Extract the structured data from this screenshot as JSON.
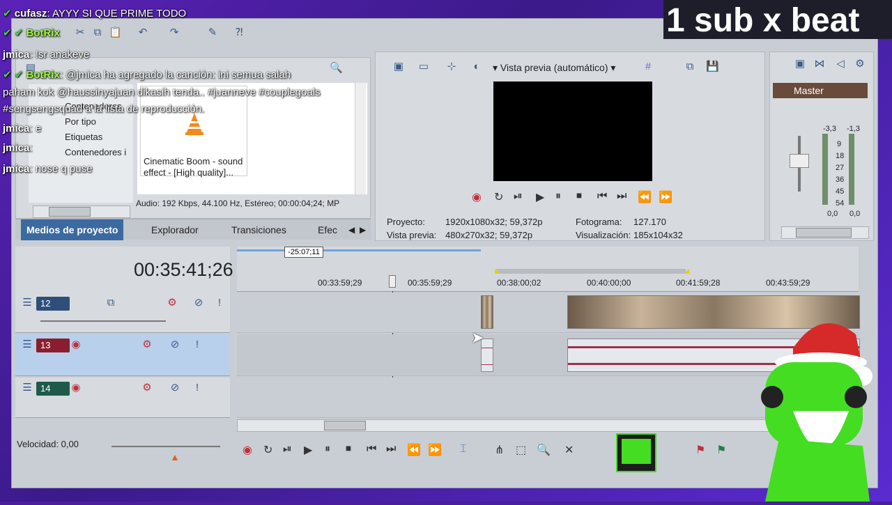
{
  "overlay": {
    "sub_text": "1 sub x beat",
    "chat": [
      {
        "user": "cufasz",
        "text": ": AYYY SI QUE PRIME TODO",
        "verified": true,
        "bot": false
      },
      {
        "user": "BotRix",
        "text": "",
        "verified": true,
        "bot": true
      },
      {
        "user": "jmica",
        "text": ": !sr anakeve",
        "verified": false,
        "bot": false
      },
      {
        "user": "BotRix",
        "text": ": @jmica ha agregado la canción: ini semua salah",
        "verified": true,
        "bot": true
      },
      {
        "user": "",
        "text": "paham kok @haussinyajuan dikasih tenda.. #juanneve #couplegoals",
        "verified": false,
        "bot": false
      },
      {
        "user": "",
        "text": "#sengsengsquad a la lista de reproducción.",
        "verified": false,
        "bot": false
      },
      {
        "user": "jmica",
        "text": ": e",
        "verified": false,
        "bot": false
      },
      {
        "user": "jmica",
        "text": ":",
        "verified": false,
        "bot": false
      },
      {
        "user": "jmica",
        "text": ": nose q puse",
        "verified": false,
        "bot": false
      }
    ]
  },
  "explorer": {
    "tree_items": [
      "Contenedores",
      "Por tipo",
      "Etiquetas",
      "Contenedores i"
    ],
    "media_title": "Cinematic Boom - sound effect - [High quality]...",
    "media_title_line1": "Cinematic Boom - sound",
    "media_title_line2": "effect - [High quality]...",
    "audio_info": "Audio: 192 Kbps, 44.100 Hz, Estéreo; 00:00:04;24; MP",
    "tabs": [
      "Medios de proyecto",
      "Explorador",
      "Transiciones",
      "Efec"
    ]
  },
  "preview": {
    "mode": "Vista previa (automático)",
    "project_label": "Proyecto:",
    "project_value": "1920x1080x32; 59,372p",
    "preview_label": "Vista previa:",
    "preview_value": "480x270x32; 59,372p",
    "frame_label": "Fotograma:",
    "frame_value": "127.170",
    "display_label": "Visualización:",
    "display_value": "185x104x32"
  },
  "mixer": {
    "title": "Master",
    "level_left": "-3,3",
    "level_right": "-1,3",
    "scale": [
      "9",
      "18",
      "27",
      "36",
      "45",
      "54"
    ],
    "bottom_left": "0,0",
    "bottom_right": "0,0"
  },
  "timeline": {
    "timecode": "00:35:41;26",
    "cursor_label": "-25:07;11",
    "ticks": [
      "00:33:59;29",
      "00:35:59;29",
      "00:38:00;02",
      "00:40:00;00",
      "00:41:59;28",
      "00:43:59;29"
    ],
    "tracks": [
      {
        "num": "12",
        "color": "#2f4f7a"
      },
      {
        "num": "13",
        "color": "#8a1e2e"
      },
      {
        "num": "14",
        "color": "#1e5a4a"
      }
    ],
    "speed_label": "Velocidad: 0,00"
  },
  "colors": {
    "accent": "#3b6aa0",
    "chat_bot": "#9bff3a"
  }
}
